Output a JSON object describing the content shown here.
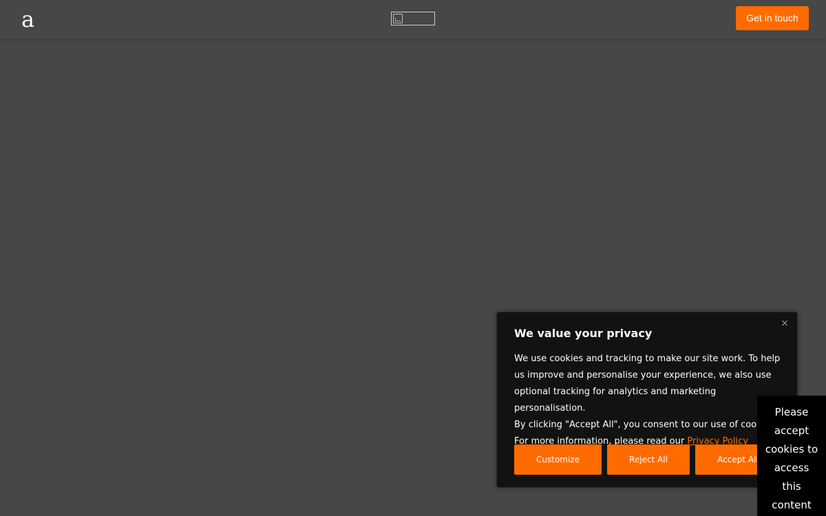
{
  "header": {
    "logo_letter": "a",
    "cta_label": "Get in touch"
  },
  "consent": {
    "title": "We value your privacy",
    "close_glyph": "×",
    "paragraph_1": "We use cookies and tracking to make our site work. To help us improve and personalise your experience, we also use optional tracking for analytics and marketing personalisation.",
    "paragraph_2_prefix": "By clicking \"Accept All\", you consent to our use of cookies. For more information, please read our ",
    "privacy_link": "Privacy Policy",
    "buttons": {
      "customize": "Customize",
      "reject": "Reject All",
      "accept": "Accept All"
    }
  },
  "content_block": {
    "message": "Please accept cookies to access this content"
  },
  "colors": {
    "background": "#474747",
    "accent": "#ff6b00",
    "dialog": "#121212"
  },
  "icons": {
    "broken_image": "broken-image-icon",
    "close": "close-icon"
  }
}
